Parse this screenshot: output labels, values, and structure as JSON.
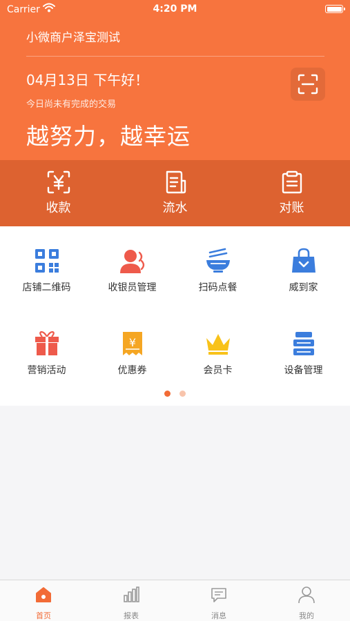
{
  "status_bar": {
    "carrier": "Carrier",
    "time": "4:20 PM"
  },
  "header": {
    "merchant_name": "小微商户泽宝测试",
    "greeting": "04月13日 下午好！",
    "notice": "今日尚未有完成的交易",
    "slogan": "越努力，越幸运"
  },
  "actions": [
    {
      "label": "收款",
      "icon": "collect-money-icon"
    },
    {
      "label": "流水",
      "icon": "transactions-icon"
    },
    {
      "label": "对账",
      "icon": "reconcile-icon"
    }
  ],
  "grid": [
    {
      "label": "店铺二维码",
      "icon": "qr-code-icon"
    },
    {
      "label": "收银员管理",
      "icon": "cashier-icon"
    },
    {
      "label": "扫码点餐",
      "icon": "noodle-bowl-icon"
    },
    {
      "label": "威到家",
      "icon": "shopping-bag-icon"
    },
    {
      "label": "营销活动",
      "icon": "gift-icon"
    },
    {
      "label": "优惠券",
      "icon": "coupon-icon"
    },
    {
      "label": "会员卡",
      "icon": "crown-icon"
    },
    {
      "label": "设备管理",
      "icon": "device-icon"
    }
  ],
  "pagination": {
    "current": 1,
    "total": 2
  },
  "tabbar": [
    {
      "label": "首页",
      "icon": "home-icon",
      "active": true
    },
    {
      "label": "报表",
      "icon": "report-icon",
      "active": false
    },
    {
      "label": "消息",
      "icon": "message-icon",
      "active": false
    },
    {
      "label": "我的",
      "icon": "profile-icon",
      "active": false
    }
  ],
  "colors": {
    "primary": "#f7743e",
    "action_bar": "#dd6230",
    "tab_active": "#f26b36"
  }
}
